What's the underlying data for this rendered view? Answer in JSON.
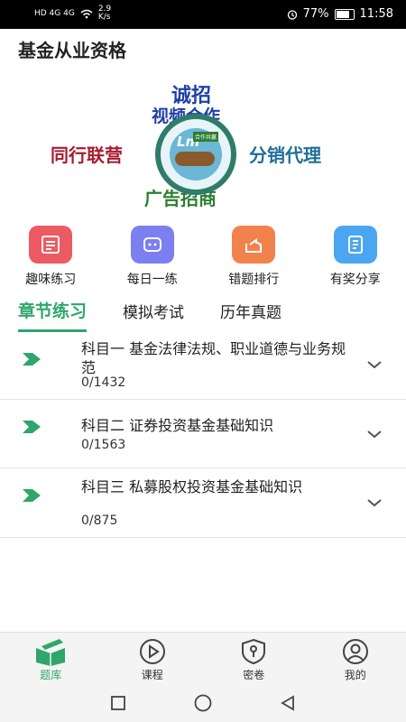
{
  "status_bar": {
    "network": "HD 4G 4G",
    "speed": "2.9 K/s",
    "battery": "77%",
    "time": "11:58"
  },
  "app": {
    "title": "基金从业资格"
  },
  "banner": {
    "line1": "诚招",
    "line2": "视频合作",
    "left": "同行联营",
    "right": "分销代理",
    "bottom": "广告招商",
    "logo_text": "Lm",
    "logo_tag": "合作共赢"
  },
  "quick_actions": [
    {
      "label": "趣味练习",
      "icon": "form-icon",
      "color": "#ec5a63"
    },
    {
      "label": "每日一练",
      "icon": "robot-icon",
      "color": "#7b7ff0"
    },
    {
      "label": "错题排行",
      "icon": "share-box-icon",
      "color": "#f2824c"
    },
    {
      "label": "有奖分享",
      "icon": "notebook-icon",
      "color": "#4aa6f0"
    }
  ],
  "tabs": [
    {
      "label": "章节练习",
      "active": true
    },
    {
      "label": "模拟考试",
      "active": false
    },
    {
      "label": "历年真题",
      "active": false
    }
  ],
  "subjects": [
    {
      "title": "科目一 基金法律法规、职业道德与业务规范",
      "count": "0/1432"
    },
    {
      "title": "科目二 证券投资基金基础知识",
      "count": "0/1563"
    },
    {
      "title": "科目三 私募股权投资基金基础知识",
      "count": "0/875"
    }
  ],
  "bottom_nav": [
    {
      "label": "题库",
      "icon": "book-icon",
      "active": true
    },
    {
      "label": "课程",
      "icon": "play-circle-icon",
      "active": false
    },
    {
      "label": "密卷",
      "icon": "shield-key-icon",
      "active": false
    },
    {
      "label": "我的",
      "icon": "user-circle-icon",
      "active": false
    }
  ],
  "colors": {
    "accent": "#2fa66b"
  }
}
